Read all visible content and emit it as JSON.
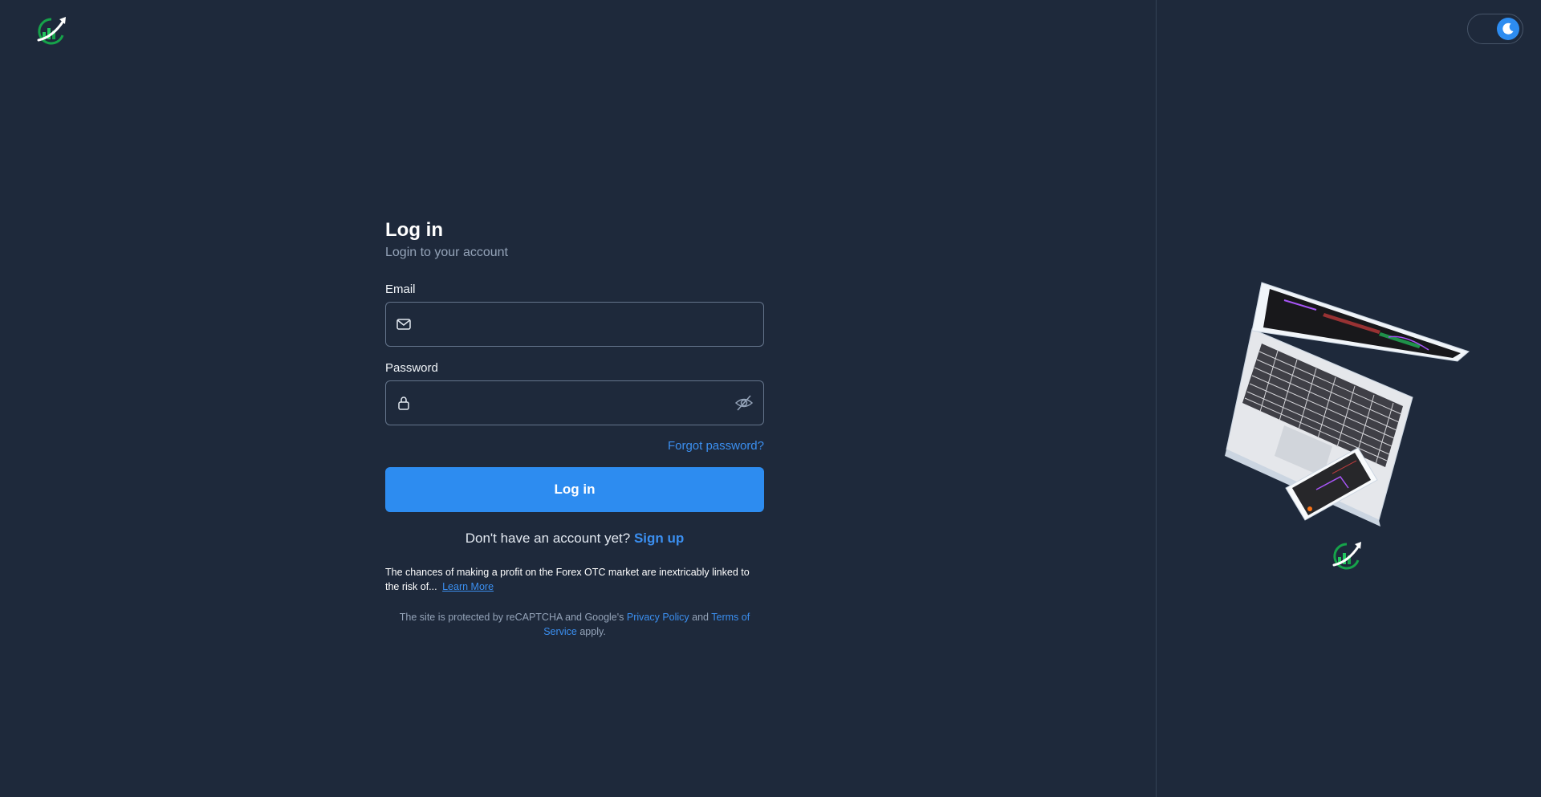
{
  "brand": {
    "logo_icon": "rising-chart-logo-icon",
    "accent_color": "#2d8cf0",
    "logo_green": "#22c55e"
  },
  "theme_toggle": {
    "icon": "moon-icon",
    "state": "dark"
  },
  "login": {
    "title": "Log in",
    "subtitle": "Login to your account",
    "email_label": "Email",
    "email_value": "",
    "email_icon": "mail-icon",
    "password_label": "Password",
    "password_value": "",
    "password_icon": "lock-icon",
    "password_visibility_icon": "eye-off-icon",
    "forgot_password": "Forgot password?",
    "submit_label": "Log in",
    "no_account_text": "Don't have an account yet?",
    "signup_label": "Sign up",
    "risk_text": "The chances of making a profit on the Forex OTC market are inextricably linked to the risk of...",
    "learn_more": "Learn More",
    "recaptcha_prefix": "The site is protected by reCAPTCHA and Google's",
    "privacy_policy": "Privacy Policy",
    "and_word": "and",
    "terms_of_service": "Terms of Service",
    "recaptcha_suffix": "apply."
  },
  "illustration": {
    "icon": "laptop-and-phone-illustration"
  }
}
